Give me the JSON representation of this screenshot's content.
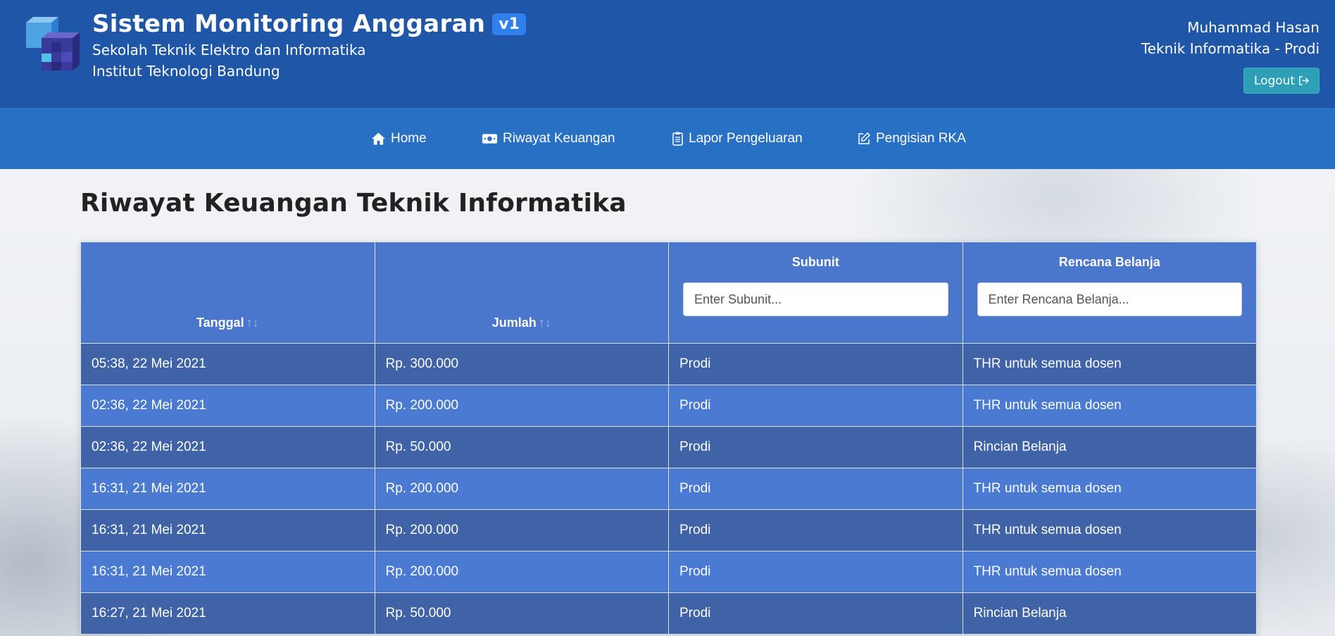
{
  "header": {
    "app_title": "Sistem Monitoring Anggaran",
    "version_badge": "v1",
    "subtitle_line1": "Sekolah Teknik Elektro dan Informatika",
    "subtitle_line2": "Institut Teknologi Bandung",
    "user_name": "Muhammad Hasan",
    "user_role": "Teknik Informatika - Prodi",
    "logout_label": "Logout"
  },
  "nav": {
    "home": "Home",
    "riwayat": "Riwayat Keuangan",
    "lapor": "Lapor Pengeluaran",
    "rka": "Pengisian RKA"
  },
  "page": {
    "title": "Riwayat Keuangan Teknik Informatika"
  },
  "table": {
    "columns": {
      "tanggal": "Tanggal",
      "jumlah": "Jumlah",
      "subunit": "Subunit",
      "rencana": "Rencana Belanja"
    },
    "filters": {
      "subunit_placeholder": "Enter Subunit...",
      "rencana_placeholder": "Enter Rencana Belanja..."
    },
    "rows": [
      {
        "tanggal": "05:38, 22 Mei 2021",
        "jumlah": "Rp. 300.000",
        "subunit": "Prodi",
        "rencana": "THR untuk semua dosen"
      },
      {
        "tanggal": "02:36, 22 Mei 2021",
        "jumlah": "Rp. 200.000",
        "subunit": "Prodi",
        "rencana": "THR untuk semua dosen"
      },
      {
        "tanggal": "02:36, 22 Mei 2021",
        "jumlah": "Rp. 50.000",
        "subunit": "Prodi",
        "rencana": "Rincian Belanja"
      },
      {
        "tanggal": "16:31, 21 Mei 2021",
        "jumlah": "Rp. 200.000",
        "subunit": "Prodi",
        "rencana": "THR untuk semua dosen"
      },
      {
        "tanggal": "16:31, 21 Mei 2021",
        "jumlah": "Rp. 200.000",
        "subunit": "Prodi",
        "rencana": "THR untuk semua dosen"
      },
      {
        "tanggal": "16:31, 21 Mei 2021",
        "jumlah": "Rp. 200.000",
        "subunit": "Prodi",
        "rencana": "THR untuk semua dosen"
      },
      {
        "tanggal": "16:27, 21 Mei 2021",
        "jumlah": "Rp. 50.000",
        "subunit": "Prodi",
        "rencana": "Rincian Belanja"
      }
    ]
  },
  "colors": {
    "header_bg": "#1f56a8",
    "navbar_bg": "#2870c4",
    "table_header_bg": "#4a76cc",
    "row_dark": "#3f63a6",
    "row_light": "#4a7ad2",
    "logout_bg": "#2da0b8",
    "badge_bg": "#2f80ed"
  },
  "icons": {
    "logo": "cube-logo-icon",
    "home": "home-icon",
    "riwayat": "money-icon",
    "lapor": "clipboard-icon",
    "rka": "edit-icon",
    "logout": "logout-icon",
    "sort": "sort-icon"
  }
}
